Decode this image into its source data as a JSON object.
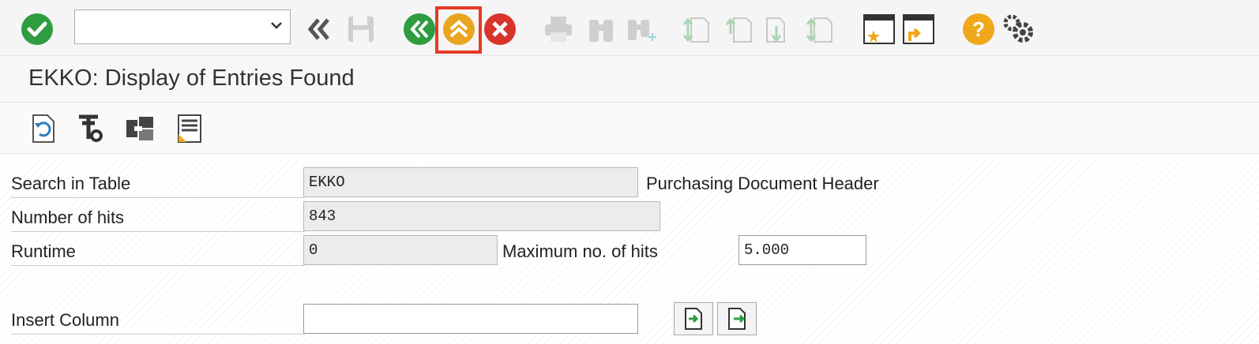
{
  "command_field": {
    "value": ""
  },
  "window": {
    "title": "EKKO: Display of Entries Found"
  },
  "icons": {
    "toolbar": [
      "checkmark-icon",
      "back-double-chevron-icon",
      "save-icon",
      "back-icon",
      "exit-icon",
      "cancel-icon",
      "print-icon",
      "find-icon",
      "find-next-icon",
      "first-page-icon",
      "previous-page-icon",
      "next-page-icon",
      "last-page-icon",
      "new-session-icon",
      "shortcut-icon",
      "help-icon",
      "settings-icon"
    ],
    "app_toolbar": [
      "refresh-icon",
      "selection-options-icon",
      "layout-icon",
      "settings-list-icon"
    ]
  },
  "colors": {
    "accent_green": "#2e9c3f",
    "exit_orange": "#e9a520",
    "cancel_red": "#d9342b",
    "highlight": "#e53b24"
  },
  "form": {
    "search_in_table": {
      "label": "Search in Table",
      "value": "EKKO",
      "description": "Purchasing Document Header"
    },
    "number_of_hits": {
      "label": "Number of hits",
      "value": "843"
    },
    "runtime": {
      "label": "Runtime",
      "value": "0"
    },
    "max_hits": {
      "label": "Maximum no. of hits",
      "value": "5.000"
    },
    "insert_column": {
      "label": "Insert Column",
      "value": ""
    }
  }
}
